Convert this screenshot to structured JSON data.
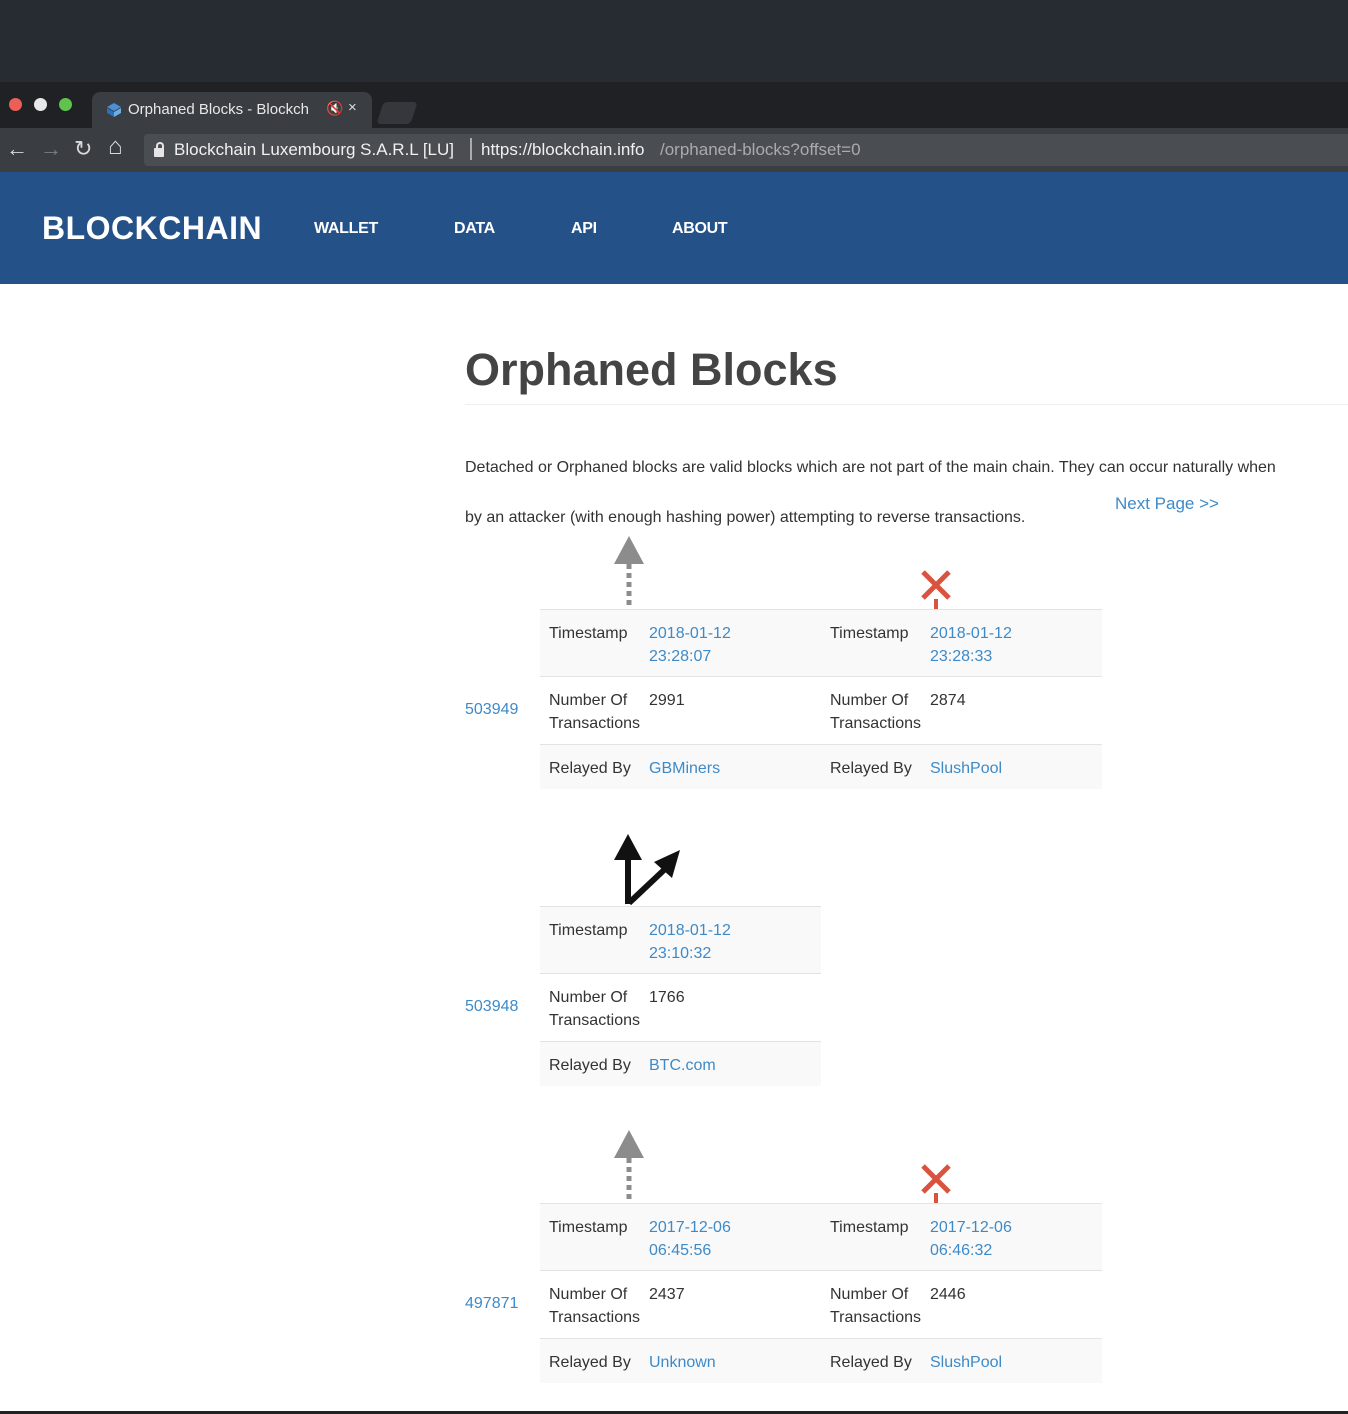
{
  "browser": {
    "tab_title": "Orphaned Blocks - Blockch",
    "tab_mute_icon": "🔇",
    "tab_close": "×",
    "nav_back": "←",
    "nav_forward": "→",
    "nav_reload": "↻",
    "nav_home": "⌂",
    "cert_org": "Blockchain Luxembourg S.A.R.L [LU]",
    "url_host": "https://blockchain.info",
    "url_path": "/orphaned-blocks?offset=0"
  },
  "site": {
    "brand": "BLOCKCHAIN",
    "nav": [
      "WALLET",
      "DATA",
      "API",
      "ABOUT"
    ],
    "header_color": "#245288",
    "link_color": "#3e8ac8"
  },
  "page": {
    "title": "Orphaned Blocks",
    "description_line1": "Detached or Orphaned blocks are valid blocks which are not part of the main chain. They can occur naturally when",
    "description_line2": "by an attacker (with enough hashing power) attempting to reverse transactions.",
    "next_page": "Next Page >>"
  },
  "labels": {
    "timestamp": "Timestamp",
    "num_tx_line1": "Number Of",
    "num_tx_line2": "Transactions",
    "relayed_by": "Relayed By"
  },
  "groups": [
    {
      "height": "503949",
      "icon": "fork-icon",
      "blocks": [
        {
          "status": "main-chain",
          "icon": "dashed-arrow-up-icon",
          "date": "2018-01-12",
          "time": "23:28:07",
          "num_tx": "2991",
          "relayed_by": "GBMiners"
        },
        {
          "status": "orphaned",
          "icon": "red-x-icon",
          "date": "2018-01-12",
          "time": "23:28:33",
          "num_tx": "2874",
          "relayed_by": "SlushPool"
        }
      ]
    },
    {
      "height": "503948",
      "icon": "branching-arrows-icon",
      "blocks": [
        {
          "status": "main-chain",
          "date": "2018-01-12",
          "time": "23:10:32",
          "num_tx": "1766",
          "relayed_by": "BTC.com"
        }
      ]
    },
    {
      "height": "497871",
      "icon": "fork-icon",
      "blocks": [
        {
          "status": "main-chain",
          "icon": "dashed-arrow-up-icon",
          "date": "2017-12-06",
          "time": "06:45:56",
          "num_tx": "2437",
          "relayed_by": "Unknown"
        },
        {
          "status": "orphaned",
          "icon": "red-x-icon",
          "date": "2017-12-06",
          "time": "06:46:32",
          "num_tx": "2446",
          "relayed_by": "SlushPool"
        }
      ]
    }
  ]
}
